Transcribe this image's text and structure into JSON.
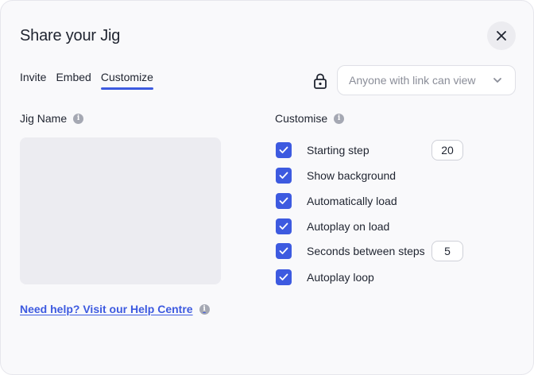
{
  "dialog": {
    "title": "Share your Jig",
    "close_icon": "close-icon"
  },
  "tabs": [
    {
      "label": "Invite",
      "active": false
    },
    {
      "label": "Embed",
      "active": false
    },
    {
      "label": "Customize",
      "active": true
    }
  ],
  "access": {
    "lock_icon": "lock-icon",
    "value": "Anyone with link can view"
  },
  "jig_name": {
    "label": "Jig Name"
  },
  "customise": {
    "label": "Customise",
    "options": [
      {
        "label": "Starting step",
        "checked": true,
        "value": "20"
      },
      {
        "label": "Show background",
        "checked": true
      },
      {
        "label": "Automatically load",
        "checked": true
      },
      {
        "label": "Autoplay on load",
        "checked": true
      },
      {
        "label": "Seconds between steps",
        "checked": true,
        "value": "5"
      },
      {
        "label": "Autoplay loop",
        "checked": true
      }
    ]
  },
  "help": {
    "link_text": "Need help? Visit our Help Centre"
  },
  "colors": {
    "accent": "#3d5ae0",
    "background": "#f9f9fb",
    "muted_text": "#8a8d98"
  }
}
